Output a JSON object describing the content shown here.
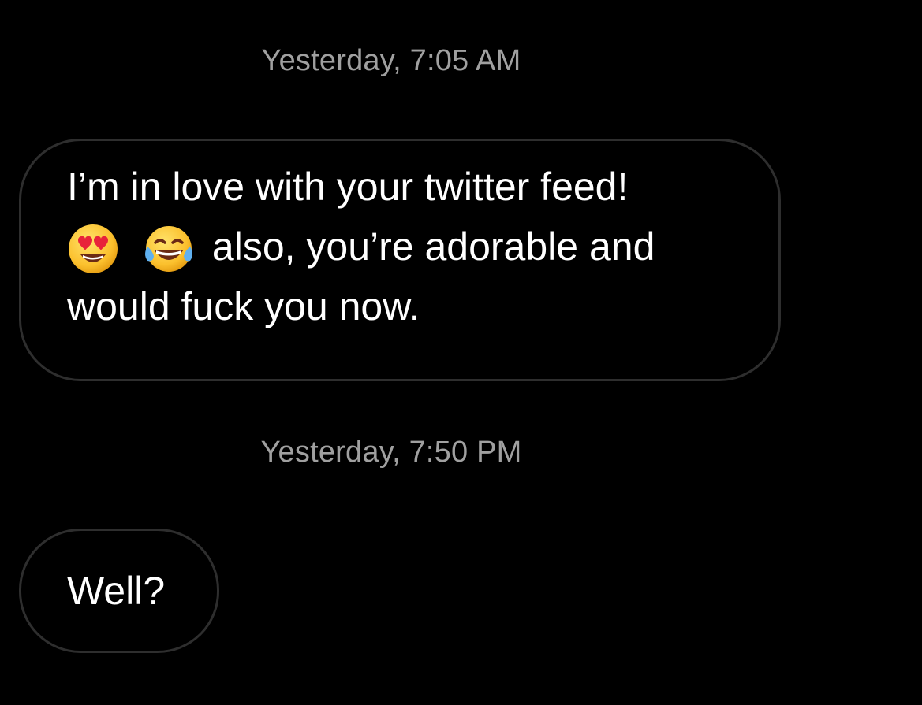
{
  "thread": {
    "messages": [
      {
        "timestamp": "Yesterday, 7:05 AM",
        "line1": "I’m in love with your twitter feed!",
        "emojis": [
          "heart-eyes-emoji",
          "tears-of-joy-emoji"
        ],
        "line2_text": "also, you’re adorable and",
        "line3": "would fuck you now."
      },
      {
        "timestamp": "Yesterday, 7:50 PM",
        "text": "Well?"
      }
    ]
  },
  "colors": {
    "background": "#000000",
    "timestamp": "#a0a0a0",
    "bubble_border": "#2e2e2e",
    "text": "#ffffff"
  }
}
